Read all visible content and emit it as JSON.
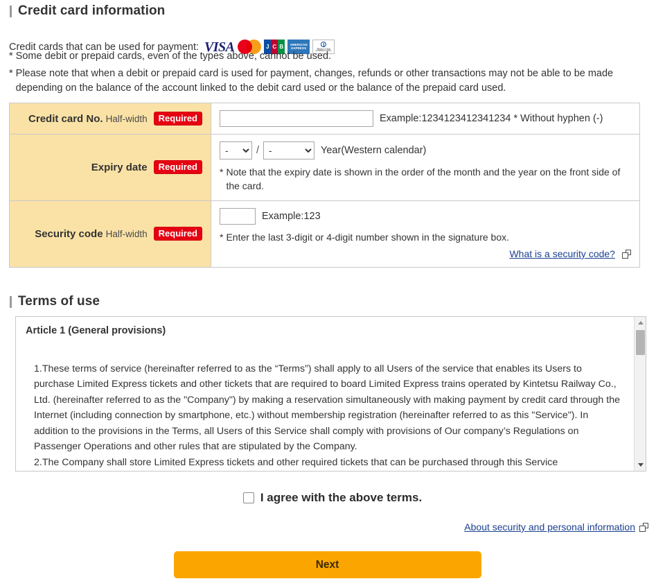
{
  "credit_card_section": {
    "heading": "Credit card information",
    "accepted_label": "Credit cards that can be used for payment:",
    "card_brands": [
      {
        "name": "visa-logo",
        "text": "VISA"
      },
      {
        "name": "mastercard-logo",
        "text": "Mastercard"
      },
      {
        "name": "jcb-logo",
        "text": "JCB"
      },
      {
        "name": "amex-logo",
        "text": "AMERICAN EXPRESS"
      },
      {
        "name": "diners-club-logo",
        "text": "Diners Club INTERNATIONAL"
      }
    ],
    "notes": [
      "Some debit or prepaid cards, even of the types above, cannot be used.",
      "Please note that when a debit or prepaid card is used for payment, changes, refunds or other transactions may not be able to be made depending on the balance of the account linked to the debit card used or the balance of the prepaid card used."
    ],
    "star": "*",
    "rows": {
      "card_number": {
        "label": "Credit card No.",
        "halfwidth": "Half-width",
        "required_badge": "Required",
        "input_value": "",
        "input_placeholder": "",
        "example": "Example:1234123412341234 * Without hyphen (-)"
      },
      "expiry": {
        "label": "Expiry date",
        "required_badge": "Required",
        "month_value": "-",
        "year_value": "-",
        "separator": "/",
        "year_suffix": "Year(Western calendar)",
        "note": "Note that the expiry date is shown in the order of the month and the year on the front side of the card."
      },
      "security_code": {
        "label": "Security code",
        "halfwidth": "Half-width",
        "required_badge": "Required",
        "input_value": "",
        "example": "Example:123",
        "note": "Enter the last 3-digit or 4-digit number shown in the signature box.",
        "help_link": "What is a security code?"
      }
    }
  },
  "terms_section": {
    "heading": "Terms of use",
    "article_title": "Article 1 (General provisions)",
    "paragraph_1": "1.These terms of service (hereinafter referred to as the “Terms”) shall apply to all Users of the service that enables its Users to purchase Limited Express tickets and other tickets that are required to board Limited Express trains operated by Kintetsu Railway Co., Ltd. (hereinafter referred to as the \"Company\") by making a reservation simultaneously with making payment by credit card through the Internet (including connection by smartphone, etc.) without membership registration (hereinafter referred to as this \"Service\"). In addition to the provisions in the Terms, all Users of this Service shall comply with provisions of Our company’s Regulations on Passenger Operations and other rules that are stipulated by the Company.",
    "paragraph_2": "2.The Company shall store Limited Express tickets and other required tickets that can be purchased through this Service"
  },
  "agreement": {
    "checkbox_label": "I agree with the above terms.",
    "checked": false
  },
  "footer": {
    "about_link": "About security and personal information",
    "next_button": "Next"
  },
  "colors": {
    "label_cell_bg": "#fae2a6",
    "required_badge": "#e60012",
    "next_button": "#fba600",
    "link": "#1a3f8f"
  }
}
